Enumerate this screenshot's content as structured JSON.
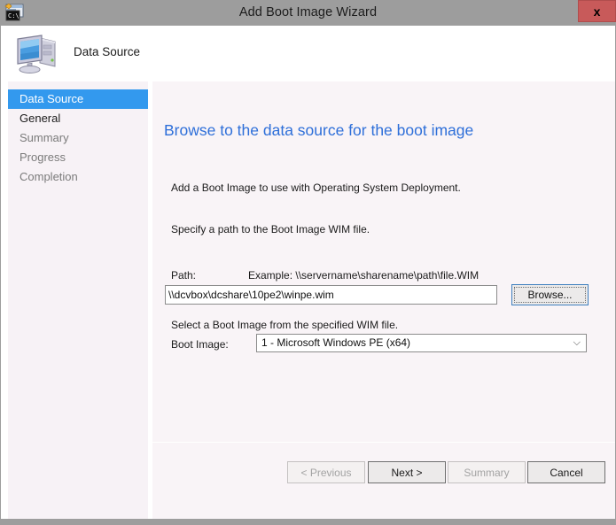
{
  "window": {
    "title": "Add Boot Image Wizard",
    "icon": "boot-image-wizard-icon",
    "close_label": "x",
    "titlebar_color": "#9d9d9d"
  },
  "header": {
    "icon": "computer-monitor-icon",
    "title": "Data Source"
  },
  "sidebar": {
    "items": [
      {
        "label": "Data Source",
        "state": "selected"
      },
      {
        "label": "General",
        "state": "done"
      },
      {
        "label": "Summary",
        "state": "pending"
      },
      {
        "label": "Progress",
        "state": "pending"
      },
      {
        "label": "Completion",
        "state": "pending"
      }
    ],
    "selected_color": "#3399ee"
  },
  "content": {
    "heading": "Browse to the data source for the boot image",
    "heading_color": "#2e6fd9",
    "paragraph_1": "Add a Boot Image to use with Operating System Deployment.",
    "paragraph_2": "Specify a path to the Boot Image WIM file.",
    "path_label": "Path:",
    "path_example": "Example: \\\\servername\\sharename\\path\\file.WIM",
    "path_value": "\\\\dcvbox\\dcshare\\10pe2\\winpe.wim",
    "path_placeholder": "",
    "browse_label": "Browse...",
    "paragraph_3": "Select a Boot Image from the specified WIM file.",
    "boot_image_label": "Boot Image:",
    "boot_image_value": "1 - Microsoft Windows PE (x64)",
    "boot_image_arrow": "⌵"
  },
  "footer": {
    "previous_label": "< Previous",
    "next_label": "Next >",
    "summary_label": "Summary",
    "cancel_label": "Cancel"
  }
}
